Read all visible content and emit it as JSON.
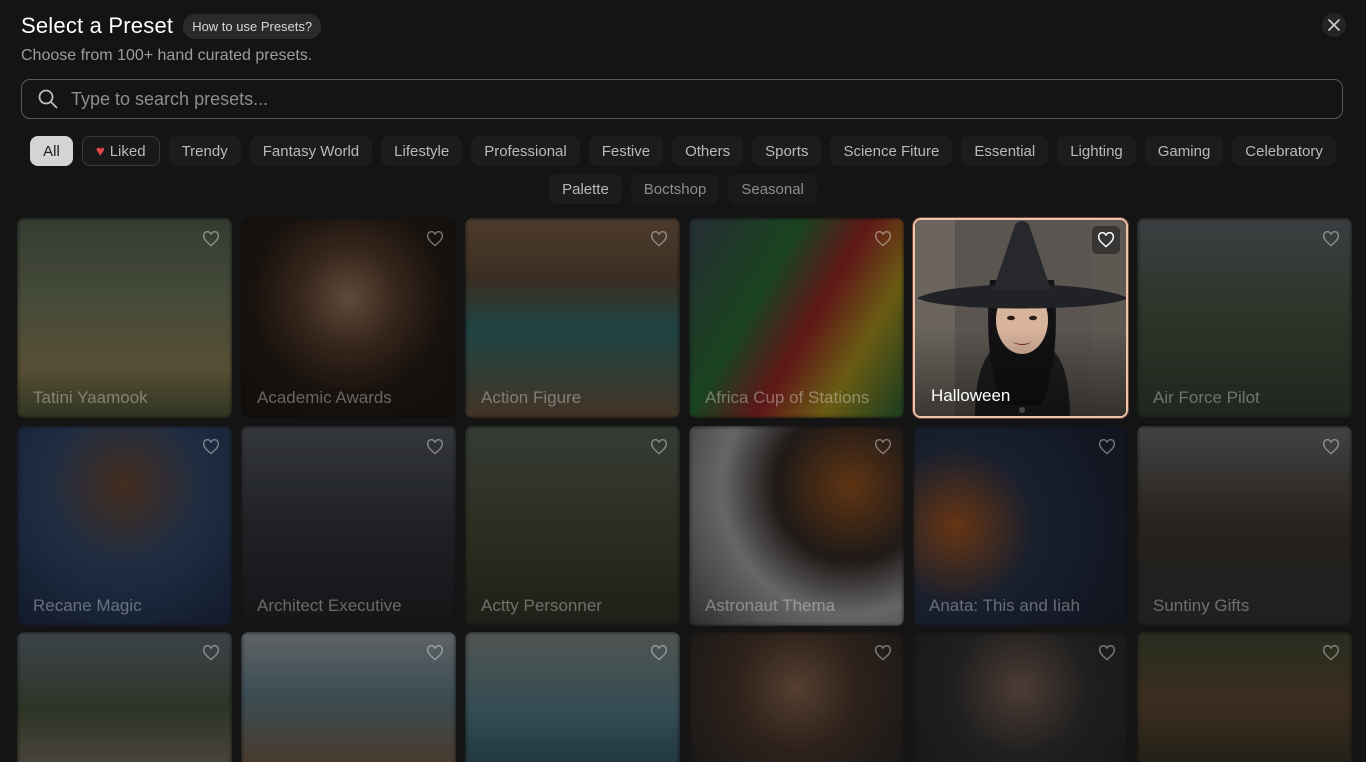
{
  "header": {
    "title": "Select a Preset",
    "help": "How to use Presets?",
    "subtitle": "Choose from 100+ hand curated presets."
  },
  "search": {
    "placeholder": "Type to search presets..."
  },
  "filters": {
    "all": "All",
    "liked": "Liked",
    "items": [
      "Trendy",
      "Fantasy World",
      "Lifestyle",
      "Professional",
      "Festive",
      "Others",
      "Sports",
      "Science Fiture",
      "Essential",
      "Lighting",
      "Gaming",
      "Celebratory",
      "Palette"
    ],
    "extra": [
      "Boctshop",
      "Seasonal"
    ]
  },
  "presets": {
    "row1": [
      "Tatini Yaamook",
      "Academic Awards",
      "Action Figure",
      "Africa Cup of Stations",
      "Halloween",
      "Air Force Pilot"
    ],
    "row2": [
      "Recane Magic",
      "Architect Executive",
      "Actty Personner",
      "Astronaut Thema",
      "Anata: This and Iiah",
      "Suntiny Gifts"
    ]
  },
  "colors": {
    "accent_border": "#f1c3ad",
    "liked_heart": "#e0484c",
    "active_chip": "#d4d4d4"
  },
  "icons": {
    "search": "search-icon",
    "close": "close-icon",
    "favorite": "heart-outline-icon",
    "liked": "heart-filled-icon"
  }
}
